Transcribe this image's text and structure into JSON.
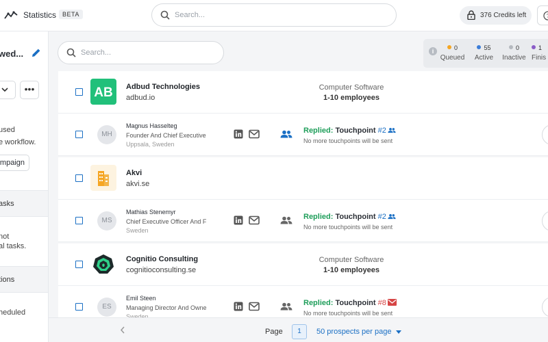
{
  "header": {
    "app_title": "Statistics",
    "badge": "BETA",
    "search_placeholder": "Search...",
    "credits": "376 Credits left"
  },
  "sidebar": {
    "campaign_title": "wed...",
    "text_line1": "used",
    "text_line2": "e workflow.",
    "button_label": "mpaign",
    "section1": "asks",
    "text_line3": "not",
    "text_line4": "al tasks.",
    "section2": "tions",
    "text_line5": "heduled"
  },
  "main": {
    "search_placeholder": "Search...",
    "stats": [
      {
        "count": "0",
        "label": "Queued",
        "color": "#f5a623"
      },
      {
        "count": "55",
        "label": "Active",
        "color": "#3b7dd8"
      },
      {
        "count": "0",
        "label": "Inactive",
        "color": "#b5b9bf"
      },
      {
        "count": "1",
        "label": "Finis",
        "color": "#8a5cc7"
      }
    ]
  },
  "companies": [
    {
      "name": "Adbud Technologies",
      "domain": "adbud.io",
      "industry": "Computer Software",
      "size": "1-10 employees",
      "logo_text": "AB",
      "logo_color": "#21c07a"
    },
    {
      "name": "Akvi",
      "domain": "akvi.se",
      "industry": "",
      "size": "",
      "logo_text": "",
      "logo_color": "#f6a623"
    },
    {
      "name": "Cognitio Consulting",
      "domain": "cognitioconsulting.se",
      "industry": "Computer Software",
      "size": "1-10 employees",
      "logo_text": "",
      "logo_color": "#1d2a2a"
    }
  ],
  "prospects": [
    {
      "initials": "MH",
      "name": "Magnus Hasselteg",
      "title": "Founder And Chief Executive",
      "location": "Uppsala, Sweden",
      "status": "Replied:",
      "touchpoint": "Touchpoint",
      "num": "#2",
      "note": "No more touchpoints will be sent"
    },
    {
      "initials": "MS",
      "name": "Mathias Stenemyr",
      "title": "Chief Executive Officer And F",
      "location": "Sweden",
      "status": "Replied:",
      "touchpoint": "Touchpoint",
      "num": "#2",
      "note": "No more touchpoints will be sent"
    },
    {
      "initials": "ES",
      "name": "Emil Steen",
      "title": "Managing Director And Owne",
      "location": "Sweden",
      "status": "Replied:",
      "touchpoint": "Touchpoint",
      "num": "#8",
      "note": "No more touchpoints will be sent"
    }
  ],
  "pager": {
    "page_label": "Page",
    "page": "1",
    "per_page": "50 prospects per page"
  },
  "icons": [
    "trend-logo-icon",
    "search-icon",
    "lock-icon",
    "help-icon",
    "pencil-icon",
    "chevron-down-icon",
    "more-icon",
    "info-icon",
    "linkedin-icon",
    "mail-icon",
    "people-icon",
    "chevron-left-icon",
    "caret-down-icon"
  ]
}
